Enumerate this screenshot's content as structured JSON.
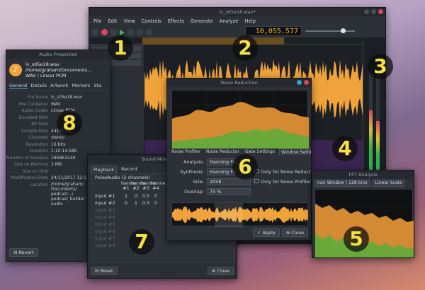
{
  "main_window": {
    "title": "lv_s05e18.wav*",
    "menu": [
      "File",
      "Edit",
      "View",
      "Controls",
      "Effects",
      "Generate",
      "Analyze",
      "Help"
    ],
    "time_display": "10,055.577"
  },
  "properties_window": {
    "title": "Audio Properties",
    "file_lines": [
      "lv_s05e18.wav",
      "/home/graham/Documents...",
      "WAV / Linear PCM"
    ],
    "tabs": [
      "General",
      "Details",
      "Artwork",
      "Markers",
      "Sta"
    ],
    "rows": [
      {
        "key": "File Name",
        "value": "lv_s05e18.wav"
      },
      {
        "key": "File Container",
        "value": "WAV"
      },
      {
        "key": "Audio Codec",
        "value": "Linear PCM"
      },
      {
        "key": "Encoded With",
        "value": ""
      },
      {
        "key": "Bit Rate",
        "value": ""
      },
      {
        "key": "Sample Rate",
        "value": "44100 Hz"
      },
      {
        "key": "Channels",
        "value": "stereo"
      },
      {
        "key": "Resolution",
        "value": "16 bits"
      },
      {
        "key": "Duration",
        "value": "1:10:14.586"
      },
      {
        "key": "Number of Samples",
        "value": "185863249"
      },
      {
        "key": "Size on Memory",
        "value": "3 MB"
      },
      {
        "key": "Size on Disk",
        "value": ""
      },
      {
        "key": "Modification Date",
        "value": "24/11/2017 12:1"
      },
      {
        "key": "Location",
        "value": "/home/graham/\nDocuments/\npodcast.../\npodcast_builder\naudio"
      }
    ],
    "revert_label": "Revert"
  },
  "noise_window": {
    "title": "Noise Reduction",
    "tabs": [
      "Noise Profiler",
      "Noise Reductor",
      "Gate Settings",
      "Window Settings"
    ],
    "analysis_label": "Analysis:",
    "analysis_value": "Hanning Fo",
    "synthesis_label": "Synthesis:",
    "synthesis_value": "Hanning Fo",
    "synthesis_note": "Only for Noise Reductor",
    "size_label": "Size:",
    "size_value": "2048",
    "size_note": "Only for Noise Profiler",
    "overlap_label": "Overlap:",
    "overlap_value": "75 %",
    "apply_label": "Apply",
    "close_label": "Close"
  },
  "mixer_window": {
    "title": "Sound Mixer Confi",
    "tabs": [
      "Playback",
      "Record"
    ],
    "device": "PulseAudio (2 channels)",
    "col_headers": [
      "hanne #1",
      "hanne #2",
      "hanne #3",
      "hanne #4"
    ],
    "inputs": [
      {
        "label": "Input #1",
        "values": [
          "1",
          "0",
          "0.5",
          "0"
        ],
        "active": true
      },
      {
        "label": "Input #2",
        "values": [
          "0",
          "1",
          "0.5",
          "0"
        ],
        "active": true
      },
      {
        "label": "Input #3",
        "values": [],
        "active": false
      },
      {
        "label": "Input #4",
        "values": [],
        "active": false
      },
      {
        "label": "Input #5",
        "values": [],
        "active": false
      },
      {
        "label": "Input #6",
        "values": [],
        "active": false
      },
      {
        "label": "Input #7",
        "values": [],
        "active": false
      },
      {
        "label": "Input #8",
        "values": [],
        "active": false
      }
    ],
    "reset_label": "Reset",
    "close_label": "Close"
  },
  "fft_window": {
    "title": "FFT Analysis",
    "window_combo": "nan Window | 128 bins",
    "scale_combo": "Linear Scale"
  },
  "callouts": [
    "1",
    "2",
    "3",
    "4",
    "5",
    "6",
    "7",
    "8"
  ],
  "colors": {
    "waveform": "#f0a33a",
    "spectrum_green": "#7bc043",
    "accent": "#3a9fd0",
    "close_red": "#d9475e"
  },
  "icons": [
    "music-note-icon",
    "close-icon",
    "apply-check-icon",
    "reset-icon"
  ]
}
